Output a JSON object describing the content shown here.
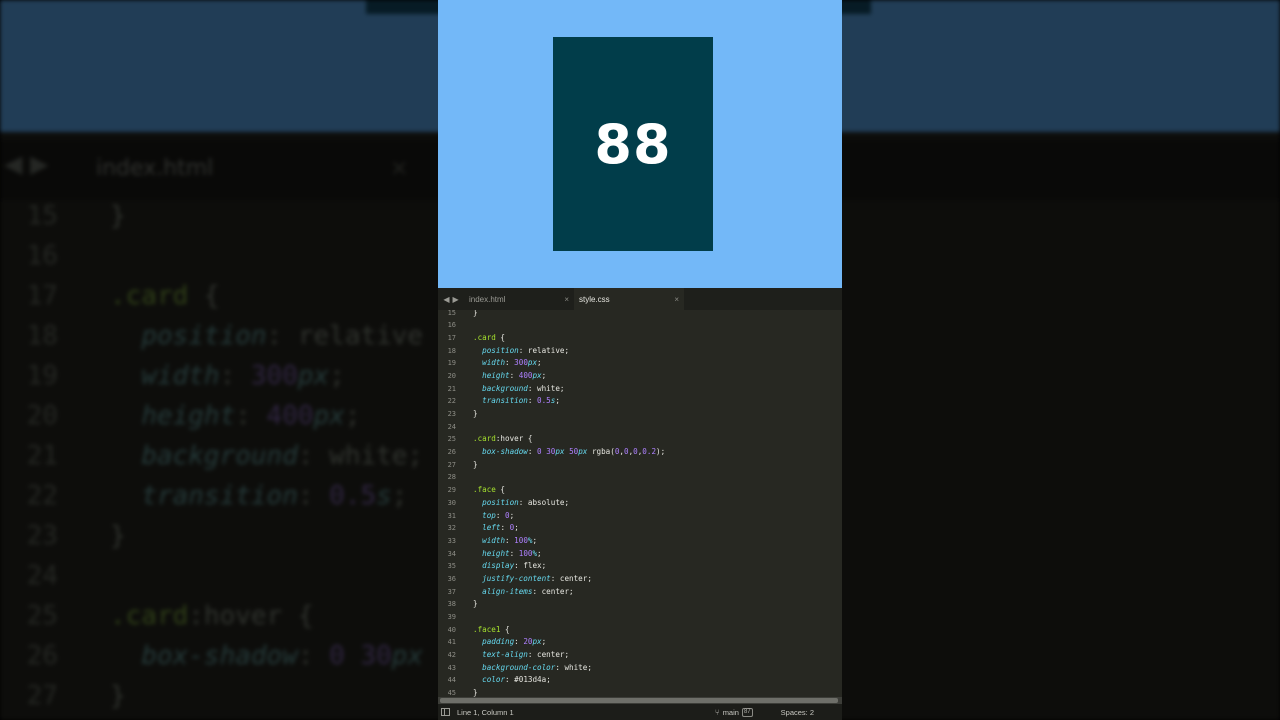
{
  "preview": {
    "card_number": "88",
    "colors": {
      "background": "#73b8f8",
      "card": "#013d4a",
      "card_text": "#ffffff"
    }
  },
  "tabs": [
    {
      "label": "index.html",
      "active": false,
      "close": "×"
    },
    {
      "label": "style.css",
      "active": true,
      "close": "×"
    }
  ],
  "nav": {
    "back": "◀",
    "forward": "▶"
  },
  "code_lines": [
    {
      "n": "15",
      "tokens": [
        [
          "pun",
          "}"
        ]
      ]
    },
    {
      "n": "16",
      "tokens": []
    },
    {
      "n": "17",
      "tokens": [
        [
          "sel",
          ".card"
        ],
        [
          "pun",
          " {"
        ]
      ]
    },
    {
      "n": "18",
      "tokens": [
        [
          "pun",
          "  "
        ],
        [
          "prop",
          "position"
        ],
        [
          "pun",
          ": "
        ],
        [
          "val",
          "relative"
        ],
        [
          "pun",
          ";"
        ]
      ]
    },
    {
      "n": "19",
      "tokens": [
        [
          "pun",
          "  "
        ],
        [
          "prop",
          "width"
        ],
        [
          "pun",
          ": "
        ],
        [
          "num",
          "300"
        ],
        [
          "prop",
          "px"
        ],
        [
          "pun",
          ";"
        ]
      ]
    },
    {
      "n": "20",
      "tokens": [
        [
          "pun",
          "  "
        ],
        [
          "prop",
          "height"
        ],
        [
          "pun",
          ": "
        ],
        [
          "num",
          "400"
        ],
        [
          "prop",
          "px"
        ],
        [
          "pun",
          ";"
        ]
      ]
    },
    {
      "n": "21",
      "tokens": [
        [
          "pun",
          "  "
        ],
        [
          "prop",
          "background"
        ],
        [
          "pun",
          ": "
        ],
        [
          "val",
          "white"
        ],
        [
          "pun",
          ";"
        ]
      ]
    },
    {
      "n": "22",
      "tokens": [
        [
          "pun",
          "  "
        ],
        [
          "prop",
          "transition"
        ],
        [
          "pun",
          ": "
        ],
        [
          "num",
          "0.5"
        ],
        [
          "prop",
          "s"
        ],
        [
          "pun",
          ";"
        ]
      ]
    },
    {
      "n": "23",
      "tokens": [
        [
          "pun",
          "}"
        ]
      ]
    },
    {
      "n": "24",
      "tokens": []
    },
    {
      "n": "25",
      "tokens": [
        [
          "sel",
          ".card"
        ],
        [
          "pun",
          ":hover {"
        ]
      ]
    },
    {
      "n": "26",
      "tokens": [
        [
          "pun",
          "  "
        ],
        [
          "prop",
          "box-shadow"
        ],
        [
          "pun",
          ": "
        ],
        [
          "num",
          "0"
        ],
        [
          "pun",
          " "
        ],
        [
          "num",
          "30"
        ],
        [
          "prop",
          "px"
        ],
        [
          "pun",
          " "
        ],
        [
          "num",
          "50"
        ],
        [
          "prop",
          "px"
        ],
        [
          "pun",
          " rgba("
        ],
        [
          "num",
          "0"
        ],
        [
          "pun",
          ","
        ],
        [
          "num",
          "0"
        ],
        [
          "pun",
          ","
        ],
        [
          "num",
          "0"
        ],
        [
          "pun",
          ","
        ],
        [
          "num",
          "0.2"
        ],
        [
          "pun",
          ");"
        ]
      ]
    },
    {
      "n": "27",
      "tokens": [
        [
          "pun",
          "}"
        ]
      ]
    },
    {
      "n": "28",
      "tokens": []
    },
    {
      "n": "29",
      "tokens": [
        [
          "sel",
          ".face"
        ],
        [
          "pun",
          " {"
        ]
      ]
    },
    {
      "n": "30",
      "tokens": [
        [
          "pun",
          "  "
        ],
        [
          "prop",
          "position"
        ],
        [
          "pun",
          ": "
        ],
        [
          "val",
          "absolute"
        ],
        [
          "pun",
          ";"
        ]
      ]
    },
    {
      "n": "31",
      "tokens": [
        [
          "pun",
          "  "
        ],
        [
          "prop",
          "top"
        ],
        [
          "pun",
          ": "
        ],
        [
          "num",
          "0"
        ],
        [
          "pun",
          ";"
        ]
      ]
    },
    {
      "n": "32",
      "tokens": [
        [
          "pun",
          "  "
        ],
        [
          "prop",
          "left"
        ],
        [
          "pun",
          ": "
        ],
        [
          "num",
          "0"
        ],
        [
          "pun",
          ";"
        ]
      ]
    },
    {
      "n": "33",
      "tokens": [
        [
          "pun",
          "  "
        ],
        [
          "prop",
          "width"
        ],
        [
          "pun",
          ": "
        ],
        [
          "num",
          "100"
        ],
        [
          "prop",
          "%"
        ],
        [
          "pun",
          ";"
        ]
      ]
    },
    {
      "n": "34",
      "tokens": [
        [
          "pun",
          "  "
        ],
        [
          "prop",
          "height"
        ],
        [
          "pun",
          ": "
        ],
        [
          "num",
          "100"
        ],
        [
          "prop",
          "%"
        ],
        [
          "pun",
          ";"
        ]
      ]
    },
    {
      "n": "35",
      "tokens": [
        [
          "pun",
          "  "
        ],
        [
          "prop",
          "display"
        ],
        [
          "pun",
          ": "
        ],
        [
          "val",
          "flex"
        ],
        [
          "pun",
          ";"
        ]
      ]
    },
    {
      "n": "36",
      "tokens": [
        [
          "pun",
          "  "
        ],
        [
          "prop",
          "justify-content"
        ],
        [
          "pun",
          ": "
        ],
        [
          "val",
          "center"
        ],
        [
          "pun",
          ";"
        ]
      ]
    },
    {
      "n": "37",
      "tokens": [
        [
          "pun",
          "  "
        ],
        [
          "prop",
          "align-items"
        ],
        [
          "pun",
          ": "
        ],
        [
          "val",
          "center"
        ],
        [
          "pun",
          ";"
        ]
      ]
    },
    {
      "n": "38",
      "tokens": [
        [
          "pun",
          "}"
        ]
      ]
    },
    {
      "n": "39",
      "tokens": []
    },
    {
      "n": "40",
      "tokens": [
        [
          "sel",
          ".face1"
        ],
        [
          "pun",
          " {"
        ]
      ]
    },
    {
      "n": "41",
      "tokens": [
        [
          "pun",
          "  "
        ],
        [
          "prop",
          "padding"
        ],
        [
          "pun",
          ": "
        ],
        [
          "num",
          "20"
        ],
        [
          "prop",
          "px"
        ],
        [
          "pun",
          ";"
        ]
      ]
    },
    {
      "n": "42",
      "tokens": [
        [
          "pun",
          "  "
        ],
        [
          "prop",
          "text-align"
        ],
        [
          "pun",
          ": "
        ],
        [
          "val",
          "center"
        ],
        [
          "pun",
          ";"
        ]
      ]
    },
    {
      "n": "43",
      "tokens": [
        [
          "pun",
          "  "
        ],
        [
          "prop",
          "background-color"
        ],
        [
          "pun",
          ": "
        ],
        [
          "val",
          "white"
        ],
        [
          "pun",
          ";"
        ]
      ]
    },
    {
      "n": "44",
      "tokens": [
        [
          "pun",
          "  "
        ],
        [
          "prop",
          "color"
        ],
        [
          "pun",
          ": "
        ],
        [
          "val",
          "#013d4a"
        ],
        [
          "pun",
          ";"
        ]
      ]
    },
    {
      "n": "45",
      "tokens": [
        [
          "pun",
          "}"
        ]
      ]
    }
  ],
  "background": {
    "tab_label": "index.html",
    "close": "×",
    "arrows": "◀ ▶",
    "lines": [
      {
        "n": "15",
        "tokens": [
          [
            "vl",
            "}"
          ]
        ]
      },
      {
        "n": "16",
        "tokens": []
      },
      {
        "n": "17",
        "tokens": [
          [
            "kw",
            ".card"
          ],
          [
            "vl",
            " {"
          ]
        ]
      },
      {
        "n": "18",
        "tokens": [
          [
            "vl",
            "  "
          ],
          [
            "pr",
            "position"
          ],
          [
            "vl",
            ": relative"
          ]
        ]
      },
      {
        "n": "19",
        "tokens": [
          [
            "vl",
            "  "
          ],
          [
            "pr",
            "width"
          ],
          [
            "vl",
            ": "
          ],
          [
            "nu",
            "300"
          ],
          [
            "pr",
            "px"
          ],
          [
            "vl",
            ";"
          ]
        ]
      },
      {
        "n": "20",
        "tokens": [
          [
            "vl",
            "  "
          ],
          [
            "pr",
            "height"
          ],
          [
            "vl",
            ": "
          ],
          [
            "nu",
            "400"
          ],
          [
            "pr",
            "px"
          ],
          [
            "vl",
            ";"
          ]
        ]
      },
      {
        "n": "21",
        "tokens": [
          [
            "vl",
            "  "
          ],
          [
            "pr",
            "background"
          ],
          [
            "vl",
            ": white;"
          ]
        ]
      },
      {
        "n": "22",
        "tokens": [
          [
            "vl",
            "  "
          ],
          [
            "pr",
            "transition"
          ],
          [
            "vl",
            ": "
          ],
          [
            "nu",
            "0.5"
          ],
          [
            "pr",
            "s"
          ],
          [
            "vl",
            ";"
          ]
        ]
      },
      {
        "n": "23",
        "tokens": [
          [
            "vl",
            "}"
          ]
        ]
      },
      {
        "n": "24",
        "tokens": []
      },
      {
        "n": "25",
        "tokens": [
          [
            "kw",
            ".card"
          ],
          [
            "vl",
            ":hover {"
          ]
        ]
      },
      {
        "n": "26",
        "tokens": [
          [
            "vl",
            "  "
          ],
          [
            "pr",
            "box-shadow"
          ],
          [
            "vl",
            ": "
          ],
          [
            "nu",
            "0 30"
          ],
          [
            "pr",
            "px"
          ]
        ]
      },
      {
        "n": "27",
        "tokens": [
          [
            "vl",
            "}"
          ]
        ]
      }
    ]
  },
  "status": {
    "position": "Line 1, Column 1",
    "branch": "main",
    "branch_count": "87",
    "spaces": "Spaces: 2"
  }
}
